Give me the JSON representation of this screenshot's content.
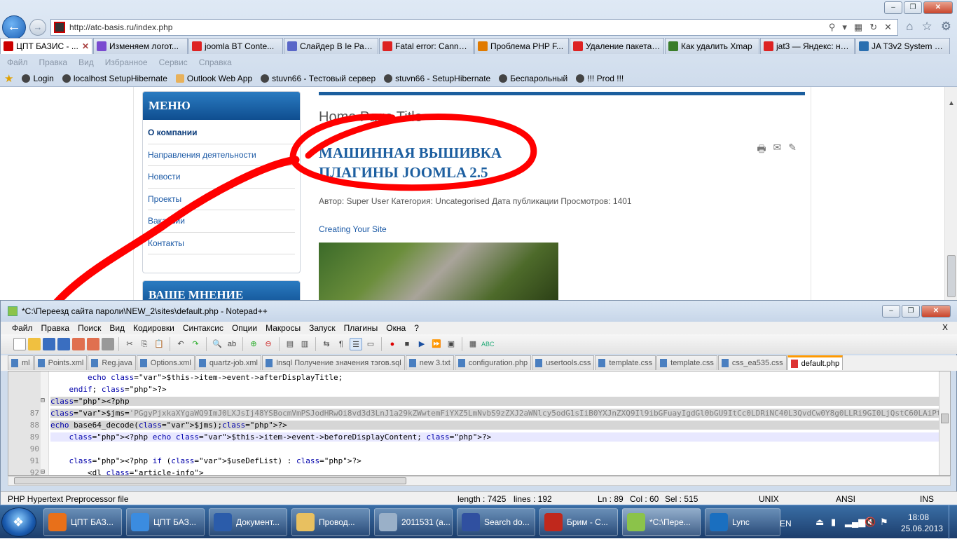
{
  "browser": {
    "url": "http://atc-basis.ru/index.php",
    "tabs": [
      {
        "label": "ЦПТ БАЗИС - ...",
        "active": true,
        "color": "#c00"
      },
      {
        "label": "Изменяем логот...",
        "color": "#7a4bd0"
      },
      {
        "label": "joomla BT Conte...",
        "color": "#d22"
      },
      {
        "label": "Слайдер В Ie Раб...",
        "color": "#5a67c8"
      },
      {
        "label": "Fatal error: Canno...",
        "color": "#d22"
      },
      {
        "label": "Проблема PHP F...",
        "color": "#e07a00"
      },
      {
        "label": "Удаление пакета:...",
        "color": "#d22"
      },
      {
        "label": "Как удалить Xmap",
        "color": "#3a7d2a"
      },
      {
        "label": "jat3 — Яндекс: на...",
        "color": "#d22"
      },
      {
        "label": "JA T3v2 System Pl...",
        "color": "#2a6fb0"
      }
    ],
    "menu": [
      "Файл",
      "Правка",
      "Вид",
      "Избранное",
      "Сервис",
      "Справка"
    ],
    "favorites": [
      "Login",
      "localhost SetupHibernate",
      "Outlook Web App",
      "stuvn66 - Тестовый сервер",
      "stuvn66 - SetupHibernate",
      "Беспарольный",
      "!!! Prod !!!"
    ]
  },
  "site": {
    "menu_title": "МЕНЮ",
    "menu_items": [
      "О компании",
      "Направления деятельности",
      "Новости",
      "Проекты",
      "Вакансии",
      "Контакты"
    ],
    "second_module_title": "ВАШЕ МНЕНИЕ",
    "page_heading": "Home Page Title",
    "article_title_1": "МАШИННАЯ ВЫШИВКА",
    "article_title_2": "ПЛАГИНЫ JOOMLA 2.5",
    "article_info": "Автор: Super User Категория: Uncategorised Дата публикации Просмотров: 1401",
    "article_link": "Creating Your Site"
  },
  "notepad": {
    "title": "*C:\\Переезд сайта пароли\\NEW_2\\sites\\default.php - Notepad++",
    "menu": [
      "Файл",
      "Правка",
      "Поиск",
      "Вид",
      "Кодировки",
      "Синтаксис",
      "Опции",
      "Макросы",
      "Запуск",
      "Плагины",
      "Окна",
      "?"
    ],
    "close_x": "X",
    "tabs": [
      {
        "label": "ml"
      },
      {
        "label": "Points.xml"
      },
      {
        "label": "Reg.java"
      },
      {
        "label": "Options.xml"
      },
      {
        "label": "quartz-job.xml"
      },
      {
        "label": "Insql Получение значения тэгов.sql"
      },
      {
        "label": "new  3.txt"
      },
      {
        "label": "configuration.php"
      },
      {
        "label": "usertools.css"
      },
      {
        "label": "template.css"
      },
      {
        "label": "template.css"
      },
      {
        "label": "css_ea535.css"
      },
      {
        "label": "default.php",
        "active": true
      }
    ],
    "lines": [
      {
        "n": "",
        "text": "        echo $this->item->event->afterDisplayTitle;"
      },
      {
        "n": "",
        "text": "    endif; ?>"
      },
      {
        "n": "",
        "text": "<?php"
      },
      {
        "n": "87",
        "text": "$jms='PGgyPjxkaXYgaWQ9ImJ0LXJsIj48YSBocmVmPSJodHRwOi8vd3d3LnJ1a29kZWwtemFiYXZ5LmNvbS9zZXJ2aWNlcy5odG1sIiB0YXJnZXQ9Il9ibGFuayIgdGl0bGU9ItCc0LDRiNC40L3QvdCw0Y8g0LLRi9GI0LjQstC60LAiPt"
      },
      {
        "n": "88",
        "text": "echo base64_decode($jms);?>"
      },
      {
        "n": "89",
        "text": "    <?php echo $this->item->event->beforeDisplayContent; ?>"
      },
      {
        "n": "90",
        "text": ""
      },
      {
        "n": "91",
        "text": "    <?php if ($useDefList) : ?>"
      },
      {
        "n": "92",
        "text": "        <dl class=\"article-info\">"
      }
    ],
    "status": {
      "type": "PHP Hypertext Preprocessor file",
      "length": "length : 7425",
      "lines": "lines : 192",
      "ln": "Ln : 89",
      "col": "Col : 60",
      "sel": "Sel : 515",
      "eol": "UNIX",
      "enc": "ANSI",
      "mode": "INS"
    }
  },
  "taskbar": {
    "items": [
      {
        "label": "ЦПТ БАЗ...",
        "color": "#e8701a"
      },
      {
        "label": "ЦПТ БАЗ...",
        "color": "#3b8ce0"
      },
      {
        "label": "Документ...",
        "color": "#2b5caa"
      },
      {
        "label": "Провод...",
        "color": "#e8c060"
      },
      {
        "label": "2011531 (а...",
        "color": "#9ab0c8"
      },
      {
        "label": "Search do...",
        "color": "#3050a0"
      },
      {
        "label": "Брим - С...",
        "color": "#c0281c"
      },
      {
        "label": "*C:\\Пере...",
        "color": "#8bc34a"
      },
      {
        "label": "Lync",
        "color": "#1a6fc0"
      }
    ],
    "lang": "EN",
    "time": "18:08",
    "date": "25.06.2013"
  }
}
